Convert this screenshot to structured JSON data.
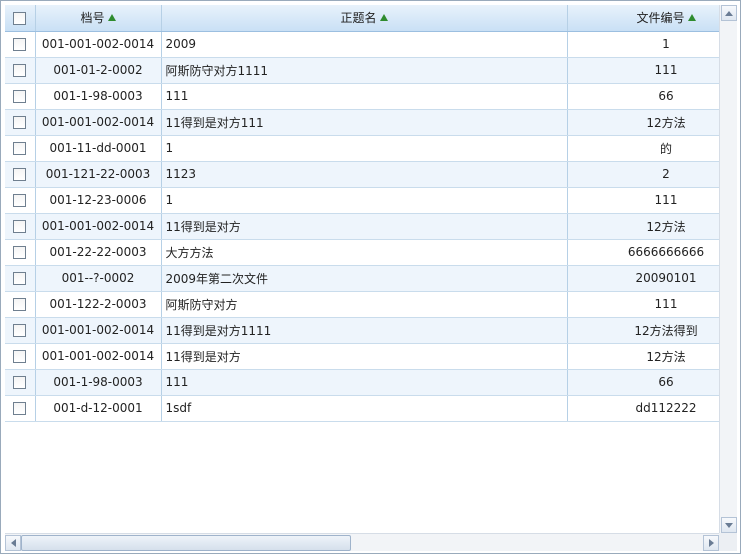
{
  "grid": {
    "columns": {
      "code": "档号",
      "title": "正题名",
      "file": "文件编号"
    },
    "rows": [
      {
        "code": "001-001-002-0014",
        "title": "2009",
        "file": "1"
      },
      {
        "code": "001-01-2-0002",
        "title": "阿斯防守对方1111",
        "file": "111"
      },
      {
        "code": "001-1-98-0003",
        "title": "111",
        "file": "66"
      },
      {
        "code": "001-001-002-0014",
        "title": "11得到是对方111",
        "file": "12方法"
      },
      {
        "code": "001-11-dd-0001",
        "title": "1",
        "file": "的"
      },
      {
        "code": "001-121-22-0003",
        "title": "1123",
        "file": "2"
      },
      {
        "code": "001-12-23-0006",
        "title": "1",
        "file": "111"
      },
      {
        "code": "001-001-002-0014",
        "title": "11得到是对方",
        "file": "12方法"
      },
      {
        "code": "001-22-22-0003",
        "title": "大方方法",
        "file": "6666666666"
      },
      {
        "code": "001--?-0002",
        "title": "2009年第二次文件",
        "file": "20090101"
      },
      {
        "code": "001-122-2-0003",
        "title": "阿斯防守对方",
        "file": "111"
      },
      {
        "code": "001-001-002-0014",
        "title": "11得到是对方1111",
        "file": "12方法得到"
      },
      {
        "code": "001-001-002-0014",
        "title": "11得到是对方",
        "file": "12方法"
      },
      {
        "code": "001-1-98-0003",
        "title": "111",
        "file": "66"
      },
      {
        "code": "001-d-12-0001",
        "title": "1sdf",
        "file": "dd112222"
      }
    ]
  },
  "colors": {
    "header_bg": "#c9e0f5",
    "alt_row": "#eef5fc",
    "sort_arrow": "#2e8b2e"
  },
  "icons": {
    "sort": "sort-asc-icon",
    "checkbox": "checkbox-icon"
  }
}
